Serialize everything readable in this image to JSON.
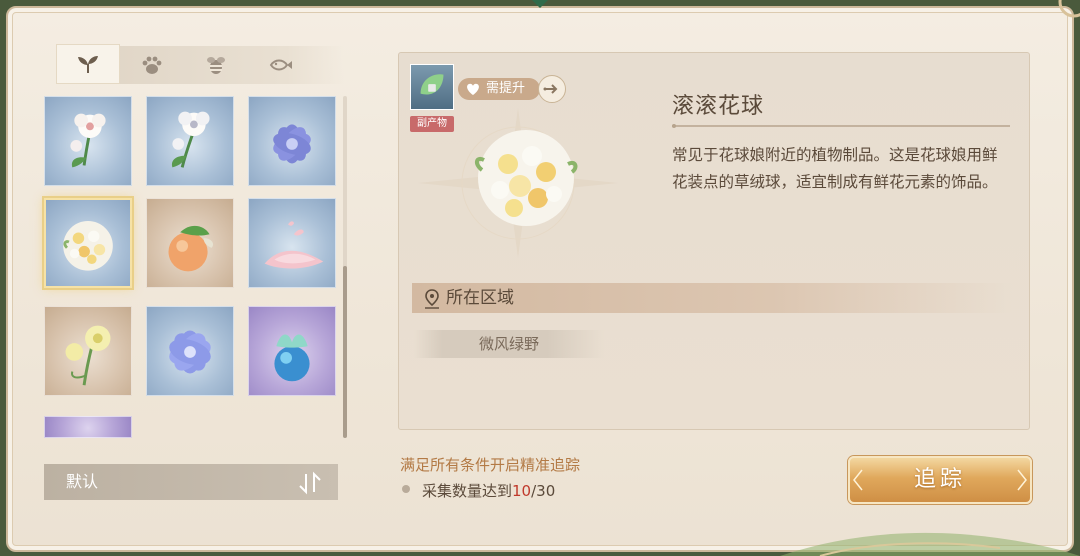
{
  "category_tabs": [
    {
      "name": "plants",
      "icon": "sprout-icon",
      "active": true
    },
    {
      "name": "animals",
      "icon": "paw-icon",
      "active": false
    },
    {
      "name": "insects",
      "icon": "bee-icon",
      "active": false
    },
    {
      "name": "fish",
      "icon": "fish-icon",
      "active": false
    }
  ],
  "items": [
    {
      "icon": "white-flower-icon",
      "bg": "blue"
    },
    {
      "icon": "white-flower-icon",
      "bg": "blue"
    },
    {
      "icon": "purple-flower-icon",
      "bg": "blue"
    },
    {
      "icon": "flower-ball-icon",
      "bg": "blue",
      "selected": true
    },
    {
      "icon": "orange-fruit-icon",
      "bg": "warm"
    },
    {
      "icon": "pink-petals-icon",
      "bg": "blue"
    },
    {
      "icon": "yellow-flower-icon",
      "bg": "warm"
    },
    {
      "icon": "blue-flower-icon",
      "bg": "blue"
    },
    {
      "icon": "glow-bud-icon",
      "bg": "purple"
    },
    {
      "icon": "partial-item-icon",
      "bg": "purple"
    }
  ],
  "sort": {
    "label": "默认"
  },
  "detail": {
    "byproduct_label": "副产物",
    "need_upgrade_label": "需提升",
    "title": "滚滚花球",
    "description": "常见于花球娘附近的植物制品。这是花球娘用鲜花装点的草绒球，适宜制成有鲜花元素的饰品。",
    "area_header": "所在区域",
    "region": "微风绿野"
  },
  "conditions": {
    "title": "满足所有条件开启精准追踪",
    "item_prefix": "采集数量达到",
    "current": "10",
    "separator": "/",
    "target": "30"
  },
  "track_button": {
    "label": "追踪"
  },
  "colors": {
    "accent_gold": "#e0a85c",
    "text_brown": "#5b4a3a",
    "highlight_red": "#c0392b",
    "condition_orange": "#b37a45"
  }
}
